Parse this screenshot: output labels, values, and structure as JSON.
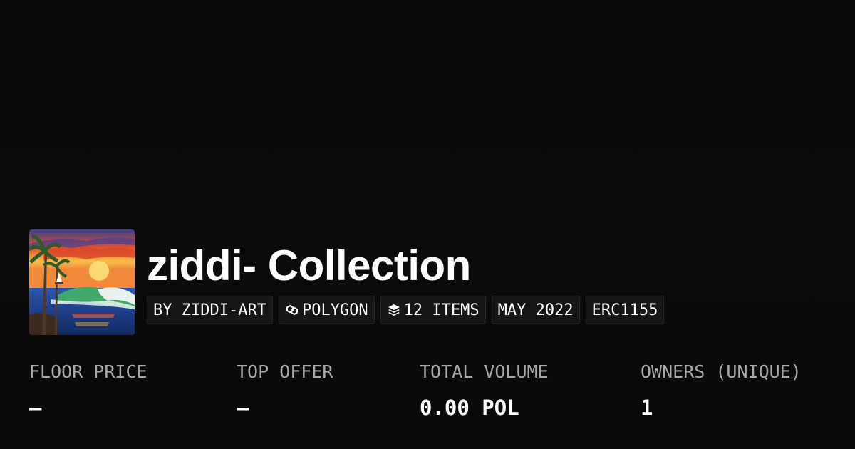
{
  "collection": {
    "name": "ziddi- Collection",
    "avatar_icon": "seascape-painting-image"
  },
  "tags": [
    {
      "label": "BY ZIDDI-ART",
      "icon": ""
    },
    {
      "label": "POLYGON",
      "icon": "polygon-chain-icon"
    },
    {
      "label": "12 ITEMS",
      "icon": "layers-icon"
    },
    {
      "label": "MAY 2022",
      "icon": ""
    },
    {
      "label": "ERC1155",
      "icon": ""
    }
  ],
  "stats": [
    {
      "label": "FLOOR PRICE",
      "value": "–"
    },
    {
      "label": "TOP OFFER",
      "value": "–"
    },
    {
      "label": "TOTAL VOLUME",
      "value": "0.00 POL"
    },
    {
      "label": "OWNERS (UNIQUE)",
      "value": "1"
    }
  ],
  "colors": {
    "background": "#0b0b0b",
    "tag_background": "#161616",
    "label_gray": "#a8a8a8"
  }
}
